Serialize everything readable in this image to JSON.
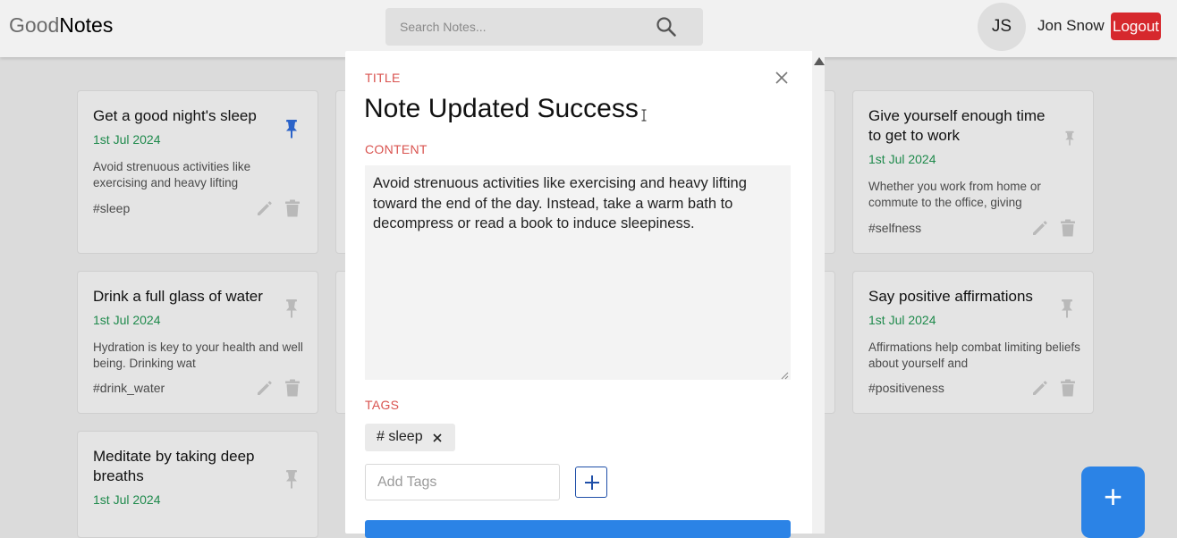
{
  "header": {
    "logo_good": "Good",
    "logo_notes": "Notes",
    "search_placeholder": "Search Notes...",
    "avatar_initials": "JS",
    "username": "Jon Snow",
    "logout_label": "Logout"
  },
  "notes": [
    {
      "title": "Get a good night's sleep",
      "date": "1st Jul 2024",
      "excerpt": "Avoid strenuous activities like exercising and heavy lifting",
      "tag": "#sleep",
      "pinned": true
    },
    {
      "title": "Give yourself enough time to get to work",
      "date": "1st Jul 2024",
      "excerpt": "Whether you work from home or commute to the office, giving",
      "tag": "#selfness",
      "pinned": false
    },
    {
      "title": "Drink a full glass of water",
      "date": "1st Jul 2024",
      "excerpt": "Hydration is key to your health and well being. Drinking wat",
      "tag": "#drink_water",
      "pinned": false
    },
    {
      "title": "Say positive affirmations",
      "date": "1st Jul 2024",
      "excerpt": "Affirmations help combat limiting beliefs about yourself and",
      "tag": "#positiveness",
      "pinned": false
    },
    {
      "title": "Meditate by taking deep breaths",
      "date": "1st Jul 2024",
      "excerpt": "",
      "tag": "",
      "pinned": false
    }
  ],
  "modal": {
    "title_label": "TITLE",
    "title_value": "Note Updated Success",
    "content_label": "CONTENT",
    "content_value": "Avoid strenuous activities like exercising and heavy lifting toward the end of the day. Instead, take a warm bath to decompress or read a book to induce sleepiness.",
    "tags_label": "TAGS",
    "tags": [
      "# sleep"
    ],
    "tag_input_placeholder": "Add Tags"
  },
  "fab_label": "+",
  "icons": {
    "search": "search-icon",
    "pin": "pin-icon",
    "edit": "pencil-icon",
    "delete": "trash-icon",
    "close": "close-icon",
    "add": "plus-icon"
  },
  "colors": {
    "accent": "#2b83e6",
    "date": "#1f8a4c",
    "label": "#d9534f",
    "logout": "#d6282d",
    "pin_active": "#2b63c9",
    "pin_inactive": "#b9b9b9",
    "icon_gray": "#b9b9b9"
  }
}
